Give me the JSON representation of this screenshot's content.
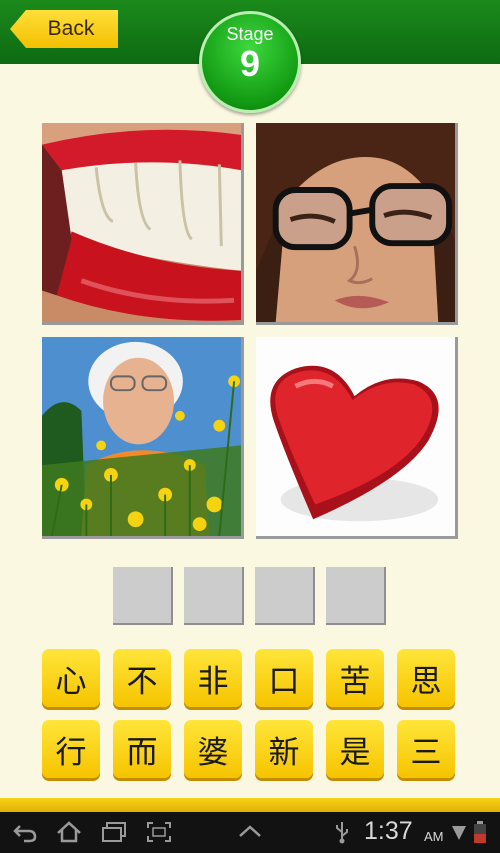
{
  "header": {
    "back_label": "Back",
    "stage_label": "Stage",
    "stage_number": "9"
  },
  "puzzle": {
    "images": [
      {
        "icon": "lips-teeth-photo"
      },
      {
        "icon": "woman-squinting-photo"
      },
      {
        "icon": "elderly-woman-flowers-photo"
      },
      {
        "icon": "red-heart-photo"
      }
    ],
    "answer_slots": [
      "",
      "",
      "",
      ""
    ]
  },
  "keyboard": {
    "row1": [
      "心",
      "不",
      "非",
      "口",
      "苦",
      "思"
    ],
    "row2": [
      "行",
      "而",
      "婆",
      "新",
      "是",
      "三"
    ]
  },
  "status_bar": {
    "time": "1:37",
    "ampm": "AM"
  },
  "colors": {
    "header_green": "#0e6a12",
    "key_yellow": "#f6c400",
    "background": "#fbf8e1"
  }
}
